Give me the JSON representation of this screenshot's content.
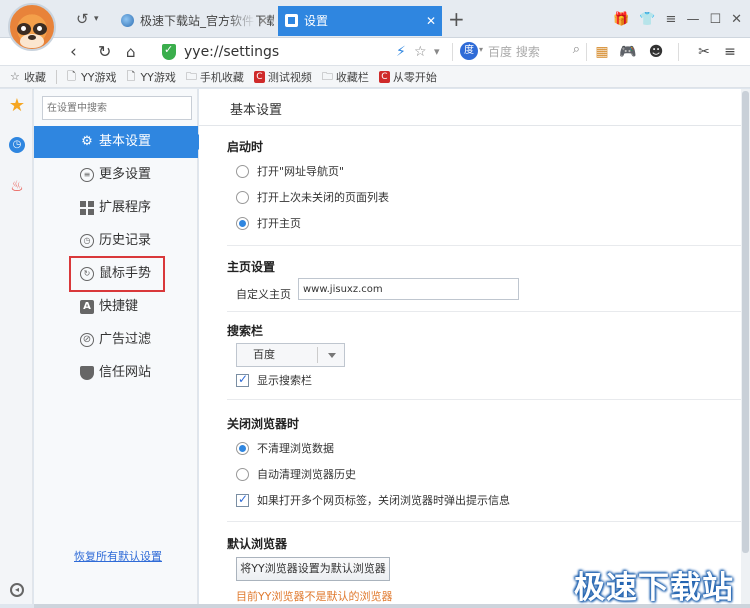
{
  "tabs": [
    {
      "label": "极速下载站_官方软件下载_绿",
      "active": false
    },
    {
      "label": "设置",
      "active": true
    }
  ],
  "address": {
    "url": "yye://settings",
    "search_placeholder": "百度 搜索"
  },
  "bookmarks": [
    {
      "label": "收藏",
      "icon": "star-icon"
    },
    {
      "label": "YY游戏",
      "icon": "page-icon"
    },
    {
      "label": "YY游戏",
      "icon": "page-icon"
    },
    {
      "label": "手机收藏",
      "icon": "folder-icon"
    },
    {
      "label": "测试视频",
      "icon": "red-c-icon"
    },
    {
      "label": "收藏栏",
      "icon": "folder-icon"
    },
    {
      "label": "从零开始",
      "icon": "red-c-icon"
    }
  ],
  "sidebar": {
    "search_placeholder": "在设置中搜索",
    "items": [
      {
        "label": "基本设置",
        "icon": "gear-icon",
        "active": true
      },
      {
        "label": "更多设置",
        "icon": "list-icon"
      },
      {
        "label": "扩展程序",
        "icon": "grid-icon"
      },
      {
        "label": "历史记录",
        "icon": "clock-icon"
      },
      {
        "label": "鼠标手势",
        "icon": "mouse-gesture-icon",
        "highlighted": true
      },
      {
        "label": "快捷键",
        "icon": "letter-a-icon"
      },
      {
        "label": "广告过滤",
        "icon": "ban-icon"
      },
      {
        "label": "信任网站",
        "icon": "shield-icon"
      }
    ],
    "restore_label": "恢复所有默认设置"
  },
  "main": {
    "page_title": "基本设置",
    "startup": {
      "title": "启动时",
      "options": [
        {
          "label": "打开\"网址导航页\"",
          "selected": false
        },
        {
          "label": "打开上次未关闭的页面列表",
          "selected": false
        },
        {
          "label": "打开主页",
          "selected": true
        }
      ]
    },
    "homepage": {
      "title": "主页设置",
      "label": "自定义主页",
      "value": "www.jisuxz.com"
    },
    "searchbar": {
      "title": "搜索栏",
      "engine": "百度",
      "show_label": "显示搜索栏",
      "show_checked": true
    },
    "close": {
      "title": "关闭浏览器时",
      "options": [
        {
          "label": "不清理浏览数据",
          "selected": true
        },
        {
          "label": "自动清理浏览器历史",
          "selected": false
        }
      ],
      "warn_label": "如果打开多个网页标签，关闭浏览器时弹出提示信息",
      "warn_checked": true
    },
    "default_browser": {
      "title": "默认浏览器",
      "button": "将YY浏览器设置为默认浏览器",
      "status": "目前YY浏览器不是默认的浏览器"
    }
  },
  "watermark": "极速下载站",
  "colors": {
    "accent": "#2f86e0",
    "highlight": "#d9383a",
    "warning": "#e07a2f"
  }
}
